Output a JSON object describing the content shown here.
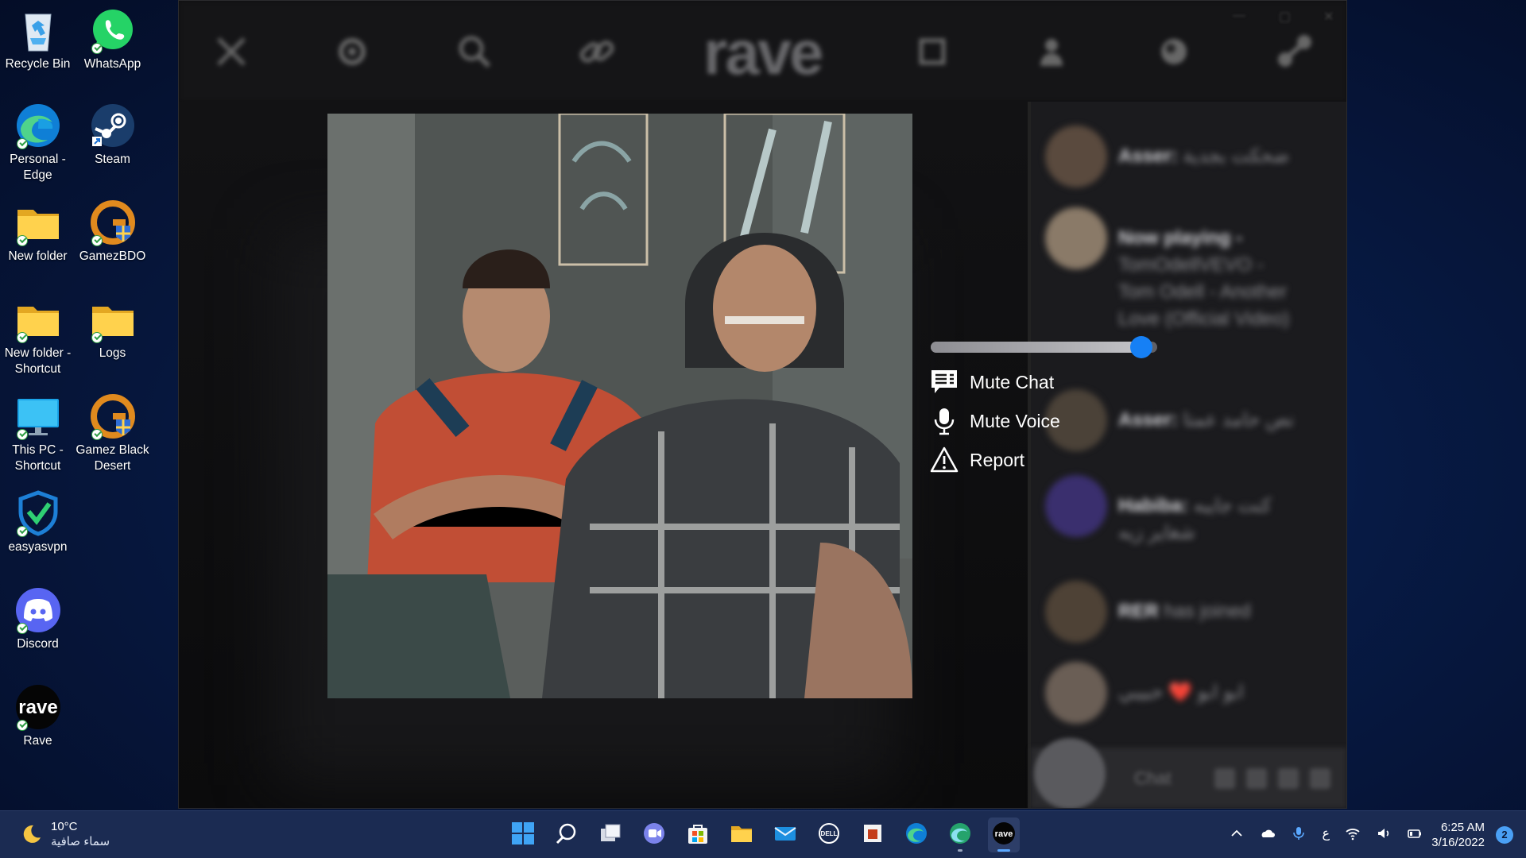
{
  "desktop": {
    "icons": [
      {
        "label": "Recycle Bin",
        "icon": "recycle-bin-icon"
      },
      {
        "label": "WhatsApp",
        "icon": "whatsapp-icon"
      },
      {
        "label": "Personal - Edge",
        "icon": "edge-icon"
      },
      {
        "label": "Steam",
        "icon": "steam-icon"
      },
      {
        "label": "New folder",
        "icon": "folder-icon"
      },
      {
        "label": "GamezBDO",
        "icon": "gamez-icon"
      },
      {
        "label": "New folder - Shortcut",
        "icon": "folder-icon"
      },
      {
        "label": "Logs",
        "icon": "folder-icon"
      },
      {
        "label": "This PC - Shortcut",
        "icon": "monitor-icon"
      },
      {
        "label": "Gamez Black Desert",
        "icon": "gamez-icon"
      },
      {
        "label": "easyasvpn",
        "icon": "vpn-shield-icon"
      },
      {
        "label": "Discord",
        "icon": "discord-icon"
      },
      {
        "label": "Rave",
        "icon": "rave-icon"
      }
    ]
  },
  "rave": {
    "brand": "rave",
    "chat": {
      "messages": [
        {
          "name": "Asser:",
          "text": "ضحكت بجدية"
        },
        {
          "name": "Now playing -",
          "text": "TomOdellVEVO - Tom Odell - Another Love (Official Video)"
        },
        {
          "name": "Asser:",
          "text": "نص حامد عمتا"
        },
        {
          "name": "Habiba:",
          "text": "كنت جايبه شغاير زيه"
        },
        {
          "name": "RER",
          "text": "has joined"
        },
        {
          "name": "",
          "text": "ابو ابو ❤️ حبيبي"
        }
      ],
      "input_placeholder": "Chat"
    },
    "profile_popup": {
      "volume_level": 0.93,
      "menu": {
        "mute_chat": "Mute Chat",
        "mute_voice": "Mute Voice",
        "report": "Report"
      }
    },
    "colors": {
      "accent": "#1680f5"
    }
  },
  "taskbar": {
    "weather": {
      "temp": "10°C",
      "condition": "سماء صافية"
    },
    "apps": [
      "windows-start-icon",
      "search-icon",
      "task-view-icon",
      "teams-chat-icon",
      "store-icon",
      "file-explorer-icon",
      "mail-icon",
      "dell-icon",
      "office-icon",
      "edge-icon",
      "edge-dev-icon",
      "rave-icon"
    ],
    "tray": {
      "language": "ع"
    },
    "clock": {
      "time": "6:25 AM",
      "date": "3/16/2022"
    },
    "notifications": "2"
  }
}
